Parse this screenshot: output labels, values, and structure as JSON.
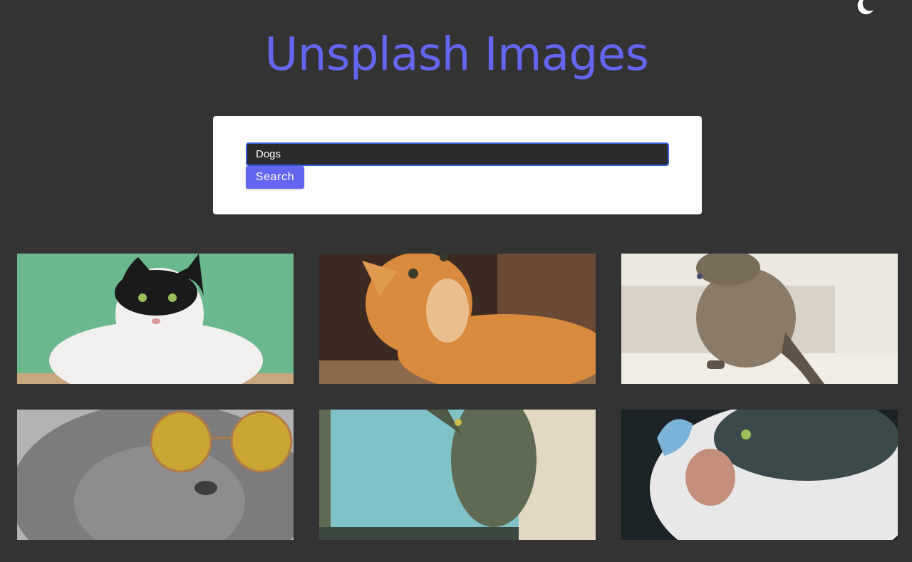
{
  "header": {
    "title": "Unsplash Images",
    "title_color": "#6366f1",
    "theme_toggle_icon": "moon-icon"
  },
  "search": {
    "value": "Dogs",
    "placeholder": "",
    "button_label": "Search",
    "button_color": "#6366f1",
    "focus_border_color": "#2f5fd8"
  },
  "images": [
    {
      "subject": "black-and-white cat on green background",
      "colors": [
        "#6bb88c",
        "#f2f0ee",
        "#1a1a1a",
        "#c8a77e"
      ]
    },
    {
      "subject": "orange tabby cat looking up",
      "colors": [
        "#3a2a22",
        "#d98a3c",
        "#f3e3c6",
        "#6b4a35"
      ]
    },
    {
      "subject": "grey tabby cat sitting on stairs",
      "colors": [
        "#ece7df",
        "#8a7b68",
        "#5f5447",
        "#d9d2c6"
      ]
    },
    {
      "subject": "grey cat wearing round sunglasses",
      "colors": [
        "#7c7c7c",
        "#c9a533",
        "#3d3d3d",
        "#b3b3b3"
      ]
    },
    {
      "subject": "tabby cat peeking from window",
      "colors": [
        "#7fc3c9",
        "#5e6b52",
        "#e4d8c4",
        "#3a4a40"
      ]
    },
    {
      "subject": "fluffy cat with butterfly on nose",
      "colors": [
        "#1b2326",
        "#e8e8e8",
        "#c48f7c",
        "#7bb3d8"
      ]
    }
  ]
}
